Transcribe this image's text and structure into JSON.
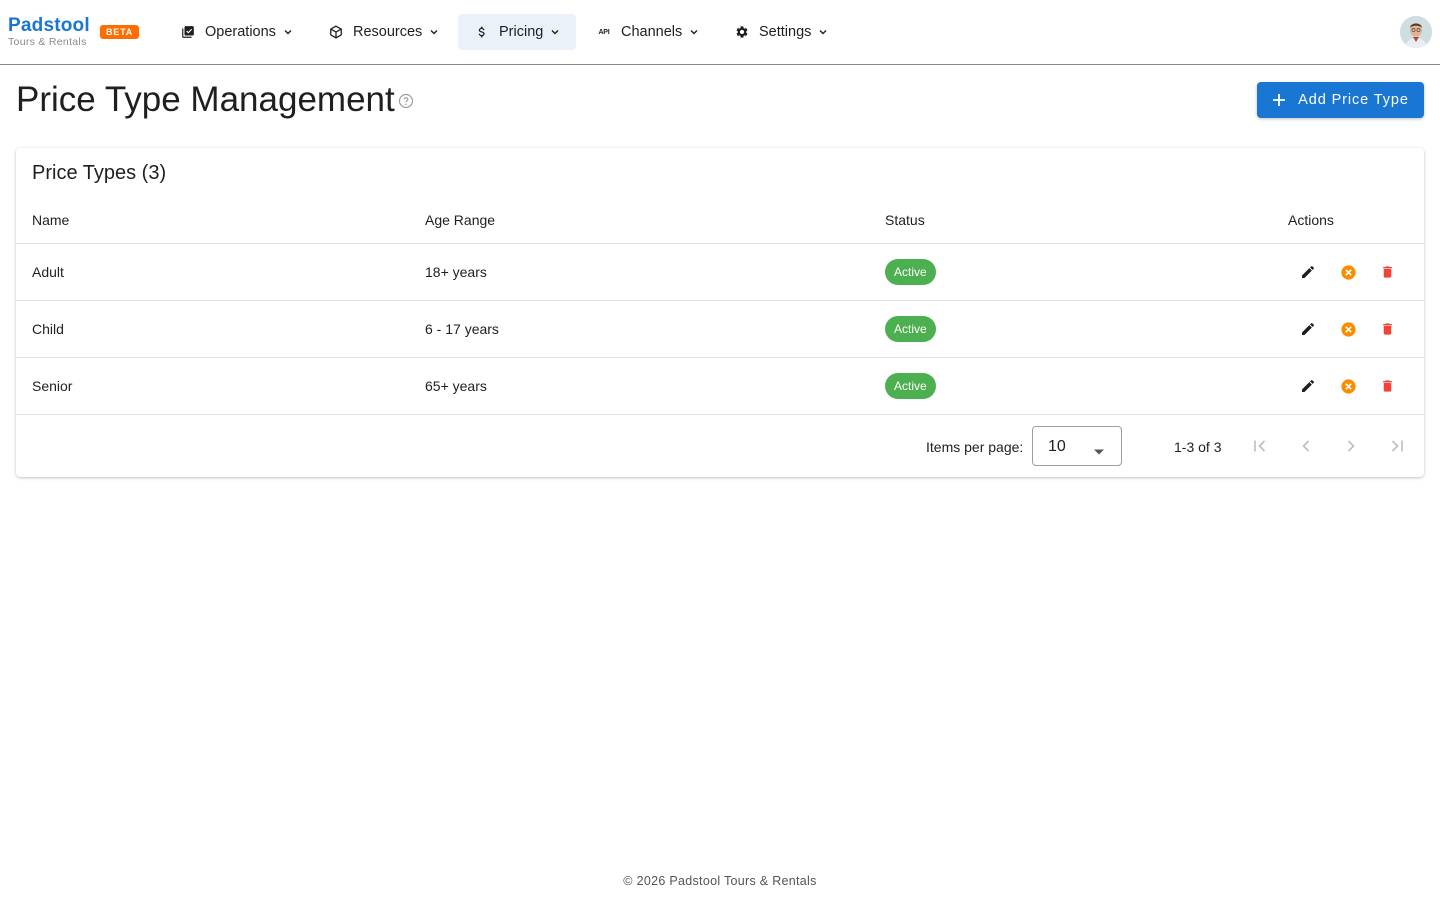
{
  "brand": {
    "name": "Padstool",
    "subtitle": "Tours & Rentals",
    "badge": "BETA"
  },
  "nav": [
    {
      "label": "Operations",
      "icon": "clipboard-check-icon"
    },
    {
      "label": "Resources",
      "icon": "cube-icon"
    },
    {
      "label": "Pricing",
      "icon": "dollar-icon",
      "active": true
    },
    {
      "label": "Channels",
      "icon": "api-icon"
    },
    {
      "label": "Settings",
      "icon": "gear-icon"
    }
  ],
  "page": {
    "title": "Price Type Management",
    "add_button_label": "Add Price Type"
  },
  "card": {
    "title": "Price Types (3)",
    "columns": [
      "Name",
      "Age Range",
      "Status",
      "Actions"
    ],
    "rows": [
      {
        "name": "Adult",
        "age_range": "18+ years",
        "status": "Active"
      },
      {
        "name": "Child",
        "age_range": "6 - 17 years",
        "status": "Active"
      },
      {
        "name": "Senior",
        "age_range": "65+ years",
        "status": "Active"
      }
    ]
  },
  "pagination": {
    "items_per_page_label": "Items per page:",
    "items_per_page": "10",
    "range_label": "1-3 of 3"
  },
  "footer": {
    "text": "© 2026 Padstool Tours & Rentals"
  },
  "colors": {
    "primary": "#1976d2",
    "beta": "#ff6d00",
    "active": "#4caf50",
    "deactivate": "#fb8c00",
    "delete": "#f44336"
  }
}
